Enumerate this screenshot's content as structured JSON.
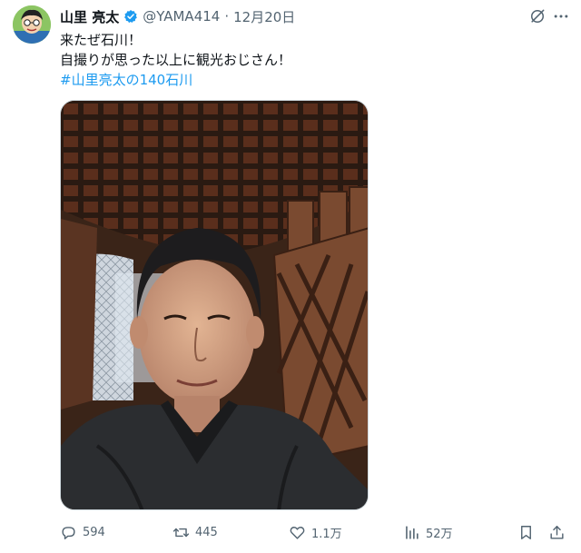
{
  "author": {
    "name": "山里 亮太",
    "handle": "@YAMA414",
    "separator": "·",
    "date": "12月20日"
  },
  "post": {
    "line1": "来たぜ石川！",
    "line2": "自撮りが思った以上に観光おじさん！",
    "hashtag": "#山里亮太の140石川"
  },
  "stats": {
    "replies": "594",
    "reposts": "445",
    "likes": "1.1万",
    "views": "52万"
  },
  "colors": {
    "accent": "#1d9bf0",
    "muted": "#536471",
    "text": "#0f1419"
  },
  "icons": {
    "verified": "verified-badge-icon",
    "grok": "grok-icon",
    "reply": "reply-icon",
    "repost": "repost-icon",
    "like": "heart-icon",
    "views": "views-chart-icon",
    "bookmark": "bookmark-icon",
    "share": "share-icon"
  }
}
